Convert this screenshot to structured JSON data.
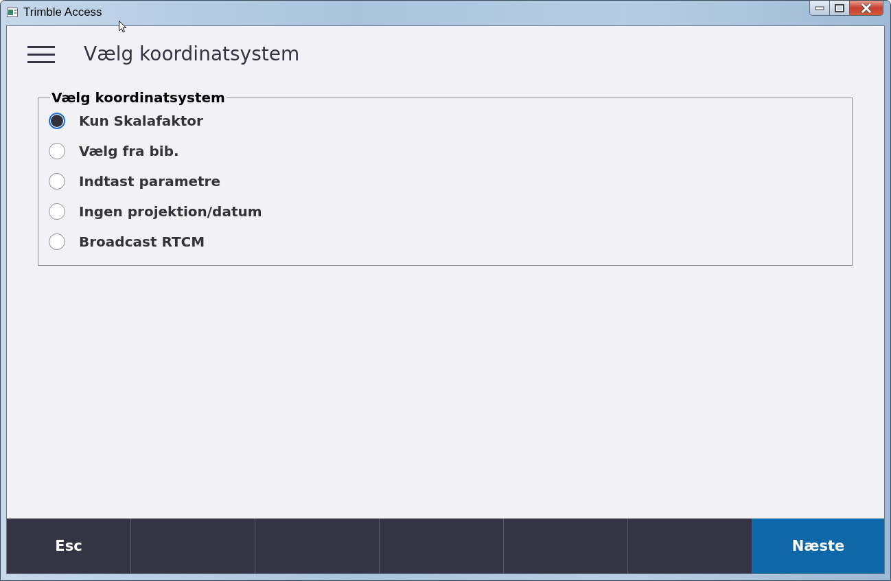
{
  "window": {
    "title": "Trimble Access"
  },
  "header": {
    "title": "Vælg koordinatsystem"
  },
  "group": {
    "legend": "Vælg koordinatsystem",
    "options": [
      {
        "label": "Kun Skalafaktor",
        "selected": true
      },
      {
        "label": "Vælg fra bib.",
        "selected": false
      },
      {
        "label": "Indtast parametre",
        "selected": false
      },
      {
        "label": "Ingen projektion/datum",
        "selected": false
      },
      {
        "label": "Broadcast RTCM",
        "selected": false
      }
    ]
  },
  "softkeys": [
    {
      "kind": "normal",
      "label": "Esc"
    },
    {
      "kind": "blank"
    },
    {
      "kind": "blank"
    },
    {
      "kind": "blank"
    },
    {
      "kind": "blank"
    },
    {
      "kind": "blank"
    },
    {
      "kind": "primary",
      "label": "Næste"
    }
  ]
}
